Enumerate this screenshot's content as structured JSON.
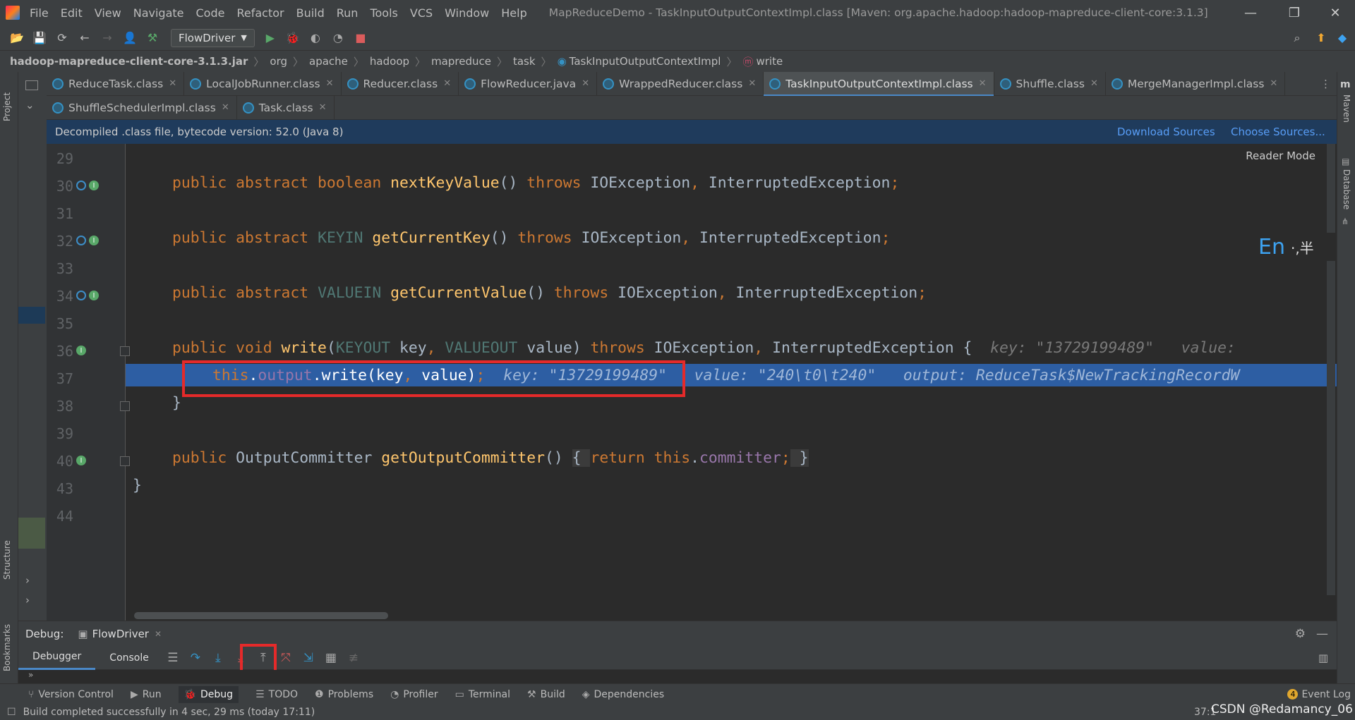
{
  "menu": {
    "items": [
      "File",
      "Edit",
      "View",
      "Navigate",
      "Code",
      "Refactor",
      "Build",
      "Run",
      "Tools",
      "VCS",
      "Window",
      "Help"
    ],
    "window_title": "MapReduceDemo - TaskInputOutputContextImpl.class [Maven: org.apache.hadoop:hadoop-mapreduce-client-core:3.1.3]"
  },
  "toolbar": {
    "run_config": "FlowDriver"
  },
  "breadcrumb": [
    "hadoop-mapreduce-client-core-3.1.3.jar",
    "org",
    "apache",
    "hadoop",
    "mapreduce",
    "task",
    "TaskInputOutputContextImpl",
    "write"
  ],
  "tabs_row1": [
    "ReduceTask.class",
    "LocalJobRunner.class",
    "Reducer.class",
    "FlowReducer.java",
    "WrappedReducer.class",
    "TaskInputOutputContextImpl.class",
    "Shuffle.class",
    "MergeManagerImpl.class"
  ],
  "tabs_row2": [
    "ShuffleSchedulerImpl.class",
    "Task.class"
  ],
  "active_tab": "TaskInputOutputContextImpl.class",
  "banner": {
    "text": "Decompiled .class file, bytecode version: 52.0 (Java 8)",
    "download": "Download Sources",
    "choose": "Choose Sources..."
  },
  "editor": {
    "reader_mode": "Reader Mode",
    "line_numbers": [
      "29",
      "30",
      "31",
      "32",
      "33",
      "34",
      "35",
      "36",
      "37",
      "38",
      "39",
      "40",
      "43",
      "44"
    ],
    "ime": {
      "lang": "En",
      "rest": "·,半"
    },
    "hints": {
      "l36": "key: \"13729199489\"   value:",
      "l37": "key: \"13729199489\"   value: \"240\\t0\\t240\"   output: ReduceTask$NewTrackingRecordW"
    }
  },
  "left_strip": {
    "project": "Project",
    "structure": "Structure",
    "bookmarks": "Bookmarks"
  },
  "right_strip": {
    "maven": "Maven",
    "database": "Database"
  },
  "debug": {
    "label": "Debug:",
    "config": "FlowDriver",
    "tabs": [
      "Debugger",
      "Console"
    ]
  },
  "tool_windows": [
    "Version Control",
    "Run",
    "Debug",
    "TODO",
    "Problems",
    "Profiler",
    "Terminal",
    "Build",
    "Dependencies"
  ],
  "event_log": {
    "count": "4",
    "label": "Event Log"
  },
  "status": {
    "message": "Build completed successfully in 4 sec, 29 ms (today 17:11)",
    "position": "37:1",
    "watermark": "CSDN @Redamancy_06"
  }
}
